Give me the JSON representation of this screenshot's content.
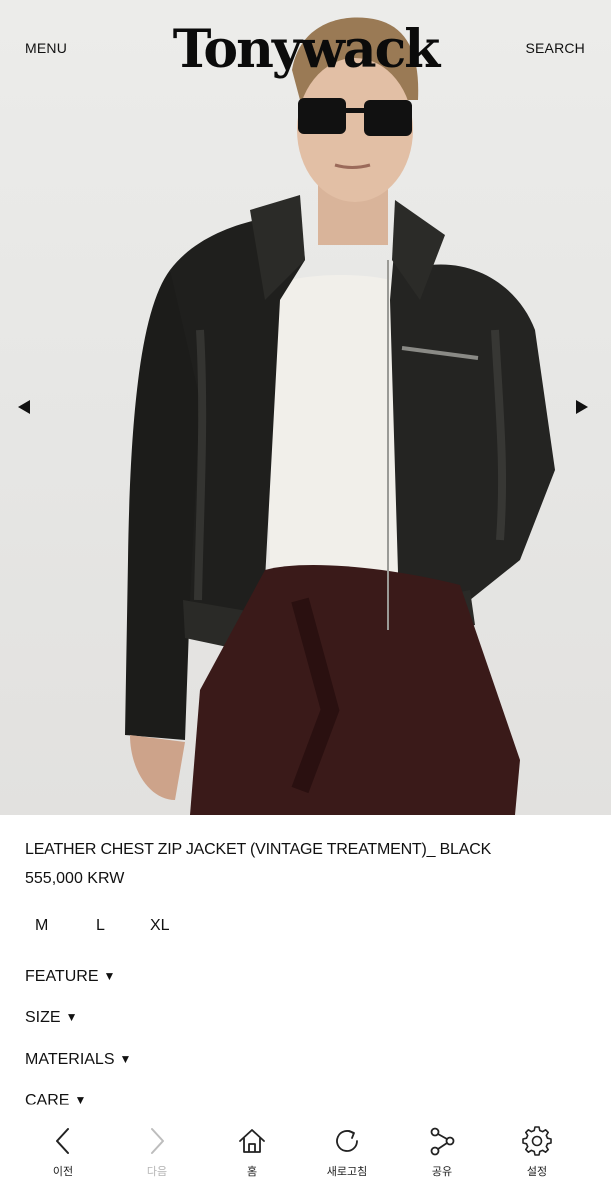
{
  "header": {
    "menu_label": "MENU",
    "logo_text": "Tonywack",
    "search_label": "SEARCH"
  },
  "hero": {
    "prev_icon": "triangle-left-icon",
    "next_icon": "triangle-right-icon"
  },
  "product": {
    "name": "LEATHER CHEST ZIP JACKET (VINTAGE TREATMENT)_ BLACK",
    "price": "555,000 KRW",
    "sizes": [
      "M",
      "L",
      "XL"
    ]
  },
  "accordion": [
    {
      "label": "FEATURE",
      "caret": "▼"
    },
    {
      "label": "SIZE",
      "caret": "▼"
    },
    {
      "label": "MATERIALS",
      "caret": "▼"
    },
    {
      "label": "CARE",
      "caret": "▼"
    }
  ],
  "bottom_nav": [
    {
      "label": "이전",
      "icon": "chevron-left-icon",
      "enabled": true
    },
    {
      "label": "다음",
      "icon": "chevron-right-icon",
      "enabled": false
    },
    {
      "label": "홈",
      "icon": "home-icon",
      "enabled": true
    },
    {
      "label": "새로고침",
      "icon": "refresh-icon",
      "enabled": true
    },
    {
      "label": "공유",
      "icon": "share-icon",
      "enabled": true
    },
    {
      "label": "설정",
      "icon": "gear-icon",
      "enabled": true
    }
  ],
  "colors": {
    "text": "#111111",
    "disabled": "#b5b5b5",
    "hero_bg": "#e8e8e6"
  }
}
